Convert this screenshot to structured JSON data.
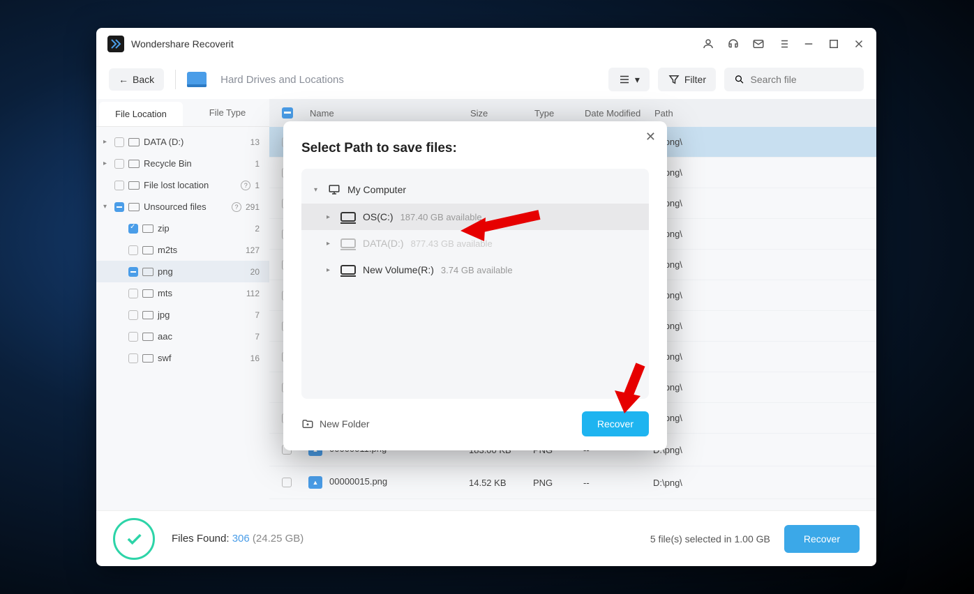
{
  "app": {
    "title": "Wondershare Recoverit"
  },
  "toolbar": {
    "back": "Back",
    "breadcrumb": "Hard Drives and Locations",
    "filter": "Filter",
    "search_placeholder": "Search file"
  },
  "sidebar": {
    "tabs": {
      "location": "File Location",
      "type": "File Type"
    },
    "items": [
      {
        "label": "DATA (D:)",
        "count": "13",
        "expand": "▸",
        "chk": "none",
        "indent": 0,
        "icon": "drive"
      },
      {
        "label": "Recycle Bin",
        "count": "1",
        "expand": "▸",
        "chk": "none",
        "indent": 0,
        "icon": "trash"
      },
      {
        "label": "File lost location",
        "count": "1",
        "expand": "",
        "chk": "none",
        "indent": 0,
        "icon": "lost",
        "help": true
      },
      {
        "label": "Unsourced files",
        "count": "291",
        "expand": "▾",
        "chk": "indeterminate",
        "indent": 0,
        "icon": "folder",
        "help": true
      },
      {
        "label": "zip",
        "count": "2",
        "expand": "",
        "chk": "checked",
        "indent": 1,
        "icon": "folder"
      },
      {
        "label": "m2ts",
        "count": "127",
        "expand": "",
        "chk": "none",
        "indent": 1,
        "icon": "folder"
      },
      {
        "label": "png",
        "count": "20",
        "expand": "",
        "chk": "indeterminate",
        "indent": 1,
        "icon": "folder",
        "selected": true
      },
      {
        "label": "mts",
        "count": "112",
        "expand": "",
        "chk": "none",
        "indent": 1,
        "icon": "folder"
      },
      {
        "label": "jpg",
        "count": "7",
        "expand": "",
        "chk": "none",
        "indent": 1,
        "icon": "folder"
      },
      {
        "label": "aac",
        "count": "7",
        "expand": "",
        "chk": "none",
        "indent": 1,
        "icon": "folder"
      },
      {
        "label": "swf",
        "count": "16",
        "expand": "",
        "chk": "none",
        "indent": 1,
        "icon": "folder"
      }
    ]
  },
  "table": {
    "cols": {
      "name": "Name",
      "size": "Size",
      "type": "Type",
      "date": "Date Modified",
      "path": "Path"
    },
    "rows": [
      {
        "name": "",
        "size": "",
        "type": "",
        "date": "",
        "path": "D:\\png\\",
        "highlighted": true
      },
      {
        "name": "",
        "size": "",
        "type": "",
        "date": "",
        "path": "D:\\png\\"
      },
      {
        "name": "",
        "size": "",
        "type": "",
        "date": "",
        "path": "D:\\png\\"
      },
      {
        "name": "",
        "size": "",
        "type": "",
        "date": "",
        "path": "D:\\png\\"
      },
      {
        "name": "",
        "size": "",
        "type": "",
        "date": "",
        "path": "D:\\png\\"
      },
      {
        "name": "",
        "size": "",
        "type": "",
        "date": "",
        "path": "D:\\png\\"
      },
      {
        "name": "",
        "size": "",
        "type": "",
        "date": "",
        "path": "D:\\png\\"
      },
      {
        "name": "",
        "size": "",
        "type": "",
        "date": "",
        "path": "D:\\png\\"
      },
      {
        "name": "",
        "size": "",
        "type": "",
        "date": "",
        "path": "D:\\png\\"
      },
      {
        "name": "",
        "size": "",
        "type": "",
        "date": "",
        "path": "D:\\png\\"
      },
      {
        "name": "00000011.png",
        "size": "183.00 KB",
        "type": "PNG",
        "date": "--",
        "path": "D:\\png\\"
      },
      {
        "name": "00000015.png",
        "size": "14.52 KB",
        "type": "PNG",
        "date": "--",
        "path": "D:\\png\\"
      }
    ]
  },
  "status": {
    "found_label": "Files Found:",
    "found_count": "306",
    "found_size": "(24.25 GB)",
    "selected": "5 file(s) selected in 1.00 GB",
    "recover": "Recover"
  },
  "modal": {
    "title": "Select Path to save files:",
    "root": "My Computer",
    "drives": [
      {
        "name": "OS(C:)",
        "avail": "187.40 GB available",
        "selected": true
      },
      {
        "name": "DATA(D:)",
        "avail": "877.43 GB available",
        "disabled": true
      },
      {
        "name": "New Volume(R:)",
        "avail": "3.74 GB available"
      }
    ],
    "new_folder": "New Folder",
    "recover": "Recover"
  }
}
